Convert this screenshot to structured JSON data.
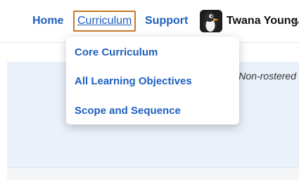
{
  "nav": {
    "home": "Home",
    "curriculum": "Curriculum",
    "support": "Support"
  },
  "user": {
    "name": "Twana Young",
    "avatar_icon": "penguin-avatar-icon"
  },
  "dropdown": {
    "items": [
      {
        "label": "Core Curriculum"
      },
      {
        "label": "All Learning Objectives"
      },
      {
        "label": "Scope and Sequence"
      }
    ]
  },
  "banner": {
    "status": "Non-rostered"
  },
  "colors": {
    "link": "#1f5fbf",
    "focus_outline": "#c8762a",
    "banner_bg": "#eaf1fb"
  }
}
